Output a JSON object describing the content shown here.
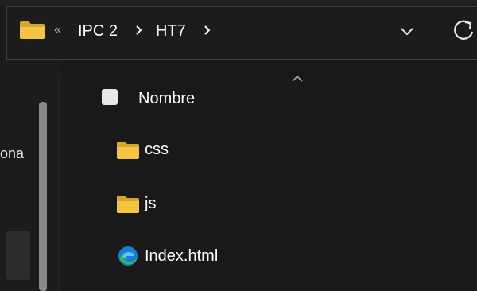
{
  "address_bar": {
    "overflow_chevron": "«",
    "breadcrumb": [
      "IPC 2",
      "HT7"
    ],
    "separator_icon": "chevron-right-icon",
    "folder_icon": "folder-icon",
    "dropdown_icon": "chevron-down-icon",
    "refresh_icon": "refresh-icon"
  },
  "nav_pane": {
    "visible_label_fragment": "ona"
  },
  "file_list": {
    "column_header": "Nombre",
    "sort_indicator": "sort-ascending-icon",
    "items": [
      {
        "name": "css",
        "icon": "folder-icon"
      },
      {
        "name": "js",
        "icon": "folder-icon"
      },
      {
        "name": "Index.html",
        "icon": "edge-browser-icon"
      }
    ]
  },
  "colors": {
    "background": "#191919",
    "folder": "#f2c23c",
    "edge_blue": "#1a7cd6",
    "edge_green": "#35c04a"
  }
}
